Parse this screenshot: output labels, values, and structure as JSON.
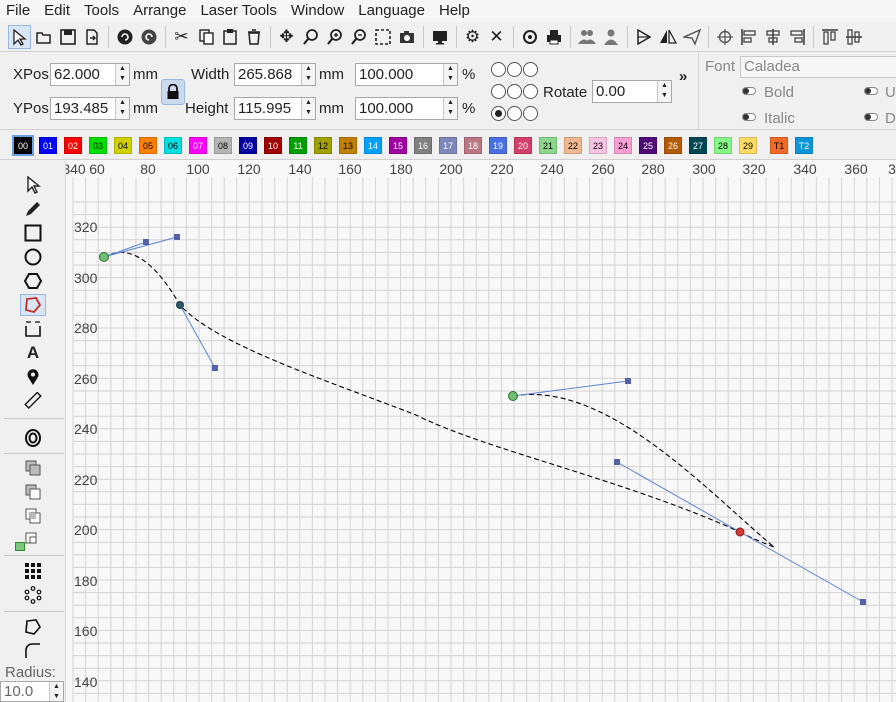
{
  "menu": [
    "File",
    "Edit",
    "Tools",
    "Arrange",
    "Laser Tools",
    "Window",
    "Language",
    "Help"
  ],
  "toolbar_icons": [
    "select-mode-icon",
    "open-folder-icon",
    "save-icon",
    "export-icon",
    "undo-icon",
    "redo-icon",
    "cut-icon",
    "copy-icon",
    "paste-icon",
    "delete-icon",
    "move-icon",
    "zoom-fit-icon",
    "zoom-in-icon",
    "zoom-out-icon",
    "zoom-selection-icon",
    "camera-icon",
    "monitor-icon",
    "settings-icon",
    "tools-icon",
    "preview-icon",
    "print-icon",
    "group-icon",
    "ungroup-icon",
    "flip-h-icon",
    "mirror-icon",
    "send-icon",
    "target-icon",
    "align-left-icon",
    "align-center-icon",
    "align-right-icon",
    "align-top-icon",
    "align-middle-icon"
  ],
  "props": {
    "xpos_label": "XPos",
    "xpos_value": "62.000",
    "ypos_label": "YPos",
    "ypos_value": "193.485",
    "unit": "mm",
    "width_label": "Width",
    "width_value": "265.868",
    "height_label": "Height",
    "height_value": "115.995",
    "scale_x_value": "100.000",
    "scale_y_value": "100.000",
    "percent": "%",
    "rotate_label": "Rotate",
    "rotate_value": "0.00",
    "more": "»"
  },
  "font_panel": {
    "font_label": "Font",
    "font_value": "Caladea",
    "bold_label": "Bold",
    "italic_label": "Italic",
    "underline_partial": "U",
    "distort_partial": "D"
  },
  "colors": [
    {
      "label": "00",
      "bg": "#000000",
      "fg": "#ffffff"
    },
    {
      "label": "01",
      "bg": "#0000ff",
      "fg": "#ffffff"
    },
    {
      "label": "02",
      "bg": "#ff0000",
      "fg": "#ffffff"
    },
    {
      "label": "03",
      "bg": "#00e000",
      "fg": "#000000"
    },
    {
      "label": "04",
      "bg": "#d0d000",
      "fg": "#000000"
    },
    {
      "label": "05",
      "bg": "#ff8000",
      "fg": "#000000"
    },
    {
      "label": "06",
      "bg": "#00e0e0",
      "fg": "#000000"
    },
    {
      "label": "07",
      "bg": "#ff00ff",
      "fg": "#ffffff"
    },
    {
      "label": "08",
      "bg": "#b4b4b4",
      "fg": "#000000"
    },
    {
      "label": "09",
      "bg": "#0000a0",
      "fg": "#ffffff"
    },
    {
      "label": "10",
      "bg": "#a00000",
      "fg": "#ffffff"
    },
    {
      "label": "11",
      "bg": "#00a000",
      "fg": "#ffffff"
    },
    {
      "label": "12",
      "bg": "#a0a000",
      "fg": "#000000"
    },
    {
      "label": "13",
      "bg": "#c08000",
      "fg": "#000000"
    },
    {
      "label": "14",
      "bg": "#00a0ff",
      "fg": "#ffffff"
    },
    {
      "label": "15",
      "bg": "#a000a0",
      "fg": "#ffffff"
    },
    {
      "label": "16",
      "bg": "#808080",
      "fg": "#ffffff"
    },
    {
      "label": "17",
      "bg": "#7d87b9",
      "fg": "#ffffff"
    },
    {
      "label": "18",
      "bg": "#bb7784",
      "fg": "#ffffff"
    },
    {
      "label": "19",
      "bg": "#4a6fe3",
      "fg": "#ffffff"
    },
    {
      "label": "20",
      "bg": "#d33f6a",
      "fg": "#ffffff"
    },
    {
      "label": "21",
      "bg": "#8cd78c",
      "fg": "#000000"
    },
    {
      "label": "22",
      "bg": "#f0b98d",
      "fg": "#000000"
    },
    {
      "label": "23",
      "bg": "#f6c4e1",
      "fg": "#000000"
    },
    {
      "label": "24",
      "bg": "#fa9ed4",
      "fg": "#000000"
    },
    {
      "label": "25",
      "bg": "#500a78",
      "fg": "#ffffff"
    },
    {
      "label": "26",
      "bg": "#b45a00",
      "fg": "#ffffff"
    },
    {
      "label": "27",
      "bg": "#004754",
      "fg": "#ffffff"
    },
    {
      "label": "28",
      "bg": "#86fa88",
      "fg": "#000000"
    },
    {
      "label": "29",
      "bg": "#ffdb66",
      "fg": "#000000"
    },
    {
      "label": "T1",
      "bg": "#f36926",
      "fg": "#000000"
    },
    {
      "label": "T2",
      "bg": "#0c96d9",
      "fg": "#ffffff"
    }
  ],
  "left_tools": [
    "select-arrow-icon",
    "pencil-icon",
    "rectangle-icon",
    "ellipse-icon",
    "polygon-icon",
    "draw-shape-icon",
    "position-bracket-icon",
    "text-icon",
    "location-pin-icon",
    "measure-ruler-icon",
    "offset-icon",
    "union-icon",
    "subtract-icon",
    "intersect-icon",
    "xor-icon",
    "grid-array-icon",
    "circular-array-icon",
    "node-edit-icon",
    "corner-round-icon"
  ],
  "radius": {
    "label": "Radius:",
    "value": "10.0"
  },
  "x_axis_labels": [
    "340",
    "60",
    "80",
    "100",
    "120",
    "140",
    "160",
    "180",
    "200",
    "220",
    "240",
    "260",
    "280",
    "300",
    "320",
    "340",
    "360",
    "3"
  ],
  "y_axis_labels": [
    "320",
    "300",
    "280",
    "260",
    "240",
    "220",
    "200",
    "180",
    "160",
    "140"
  ]
}
